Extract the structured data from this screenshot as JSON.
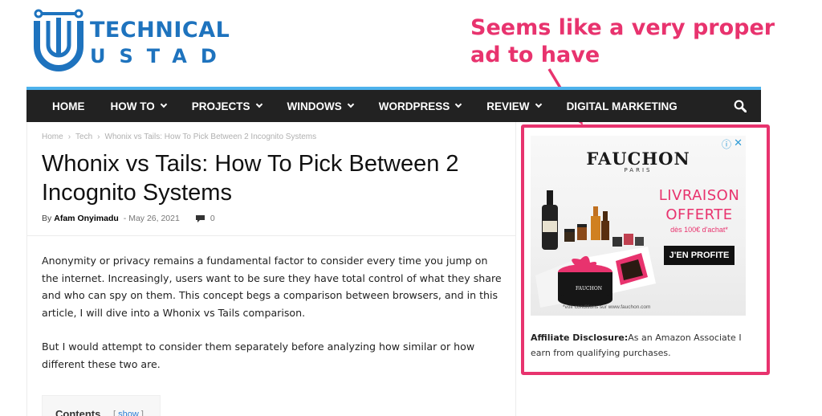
{
  "logo": {
    "line1": "TECHNICAL",
    "line2": "USTAD",
    "color": "#1e73be"
  },
  "annotation": {
    "text": "Seems like a very proper ad to have",
    "color": "#e8336e"
  },
  "nav": {
    "items": [
      {
        "label": "HOME",
        "dropdown": false
      },
      {
        "label": "HOW TO",
        "dropdown": true
      },
      {
        "label": "PROJECTS",
        "dropdown": true
      },
      {
        "label": "WINDOWS",
        "dropdown": true
      },
      {
        "label": "WORDPRESS",
        "dropdown": true
      },
      {
        "label": "REVIEW",
        "dropdown": true
      },
      {
        "label": "DIGITAL MARKETING",
        "dropdown": false
      }
    ],
    "search_icon": "search-icon",
    "accent": "#4db2ec"
  },
  "breadcrumb": {
    "home": "Home",
    "category": "Tech",
    "current": "Whonix vs Tails: How To Pick Between 2 Incognito Systems"
  },
  "article": {
    "title": "Whonix vs Tails: How To Pick Between 2 Incognito Systems",
    "by": "By",
    "author": "Afam Onyimadu",
    "date": "- May 26, 2021",
    "comments": "0",
    "para1": "Anonymity or privacy remains a fundamental factor to consider every time you jump on the internet. Increasingly, users want to be sure they have total control of what they share and who can spy on them. This concept begs a comparison between browsers, and in this article, I will dive into a Whonix vs Tails comparison.",
    "para2": "But I would attempt to consider them separately before analyzing how similar or how different these two are."
  },
  "toc": {
    "title": "Contents",
    "bracket_open": "[",
    "show": "show",
    "bracket_close": "]"
  },
  "ad": {
    "brand": "FAUCHON",
    "brand_sub": "PARIS",
    "offer_line1": "LIVRAISON",
    "offer_line2": "OFFERTE",
    "offer_line3": "dès 100€ d'achat*",
    "cta": "J'EN PROFITE",
    "footnote": "*voir conditions sur www.fauchon.com",
    "box_brand": "FAUCHON",
    "info_icon": "ⓘ",
    "close_icon": "✕",
    "highlight_color": "#e8336e"
  },
  "disclosure": {
    "label": "Affiliate Disclosure:",
    "text": "As an Amazon Associate I earn from qualifying purchases."
  }
}
